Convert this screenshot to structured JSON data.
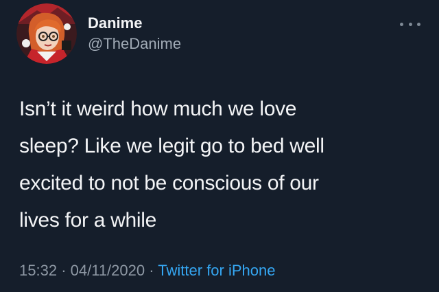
{
  "tweet": {
    "author": {
      "display_name": "Danime",
      "handle": "@TheDanime"
    },
    "more_icon": "more-horizontal-icon",
    "text_lines": [
      "Isn’t it weird how much we love",
      "sleep? Like we legit go to bed well",
      "excited to not be conscious of our",
      "lives for a while"
    ],
    "time": "15:32",
    "separator": "·",
    "date": "04/11/2020",
    "source": "Twitter for iPhone"
  },
  "colors": {
    "background": "#151e2b",
    "text_primary": "#f3f4f6",
    "text_secondary": "#8e98a4",
    "link": "#35a7f3"
  }
}
